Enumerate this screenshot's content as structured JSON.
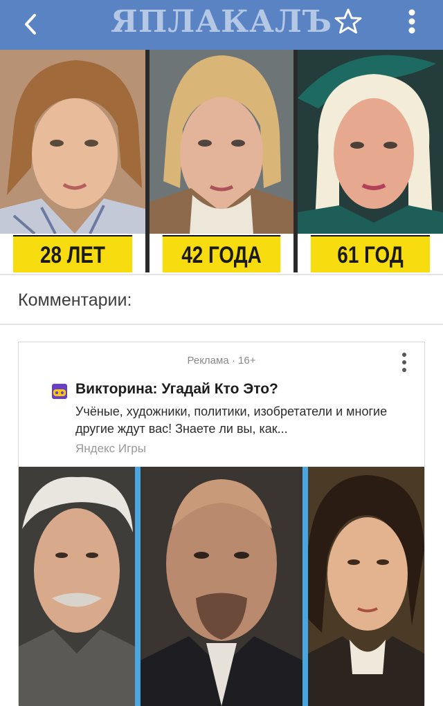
{
  "header": {
    "logo_text": "ЯПЛАКАЛЪ",
    "back_icon": "chevron-left-icon",
    "favorite_icon": "star-outline-icon",
    "menu_icon": "more-vertical-icon",
    "bar_color": "#5a83c4"
  },
  "photo_strip": {
    "panels": [
      {
        "label": "28 ЛЕТ"
      },
      {
        "label": "42 ГОДА"
      },
      {
        "label": "61 ГОД"
      }
    ],
    "label_color": "#f7dc0f"
  },
  "comments": {
    "title": "Комментарии:"
  },
  "ad": {
    "meta": "Реклама · 16+",
    "title": "Викторина: Угадай Кто Это?",
    "description": "Учёные, художники, политики, изобретатели и многие другие ждут вас! Знаете ли вы, как...",
    "source": "Яндекс Игры",
    "icon": "game-quiz-icon",
    "menu_icon": "more-vertical-icon",
    "accent_color": "#4aa6e0"
  }
}
